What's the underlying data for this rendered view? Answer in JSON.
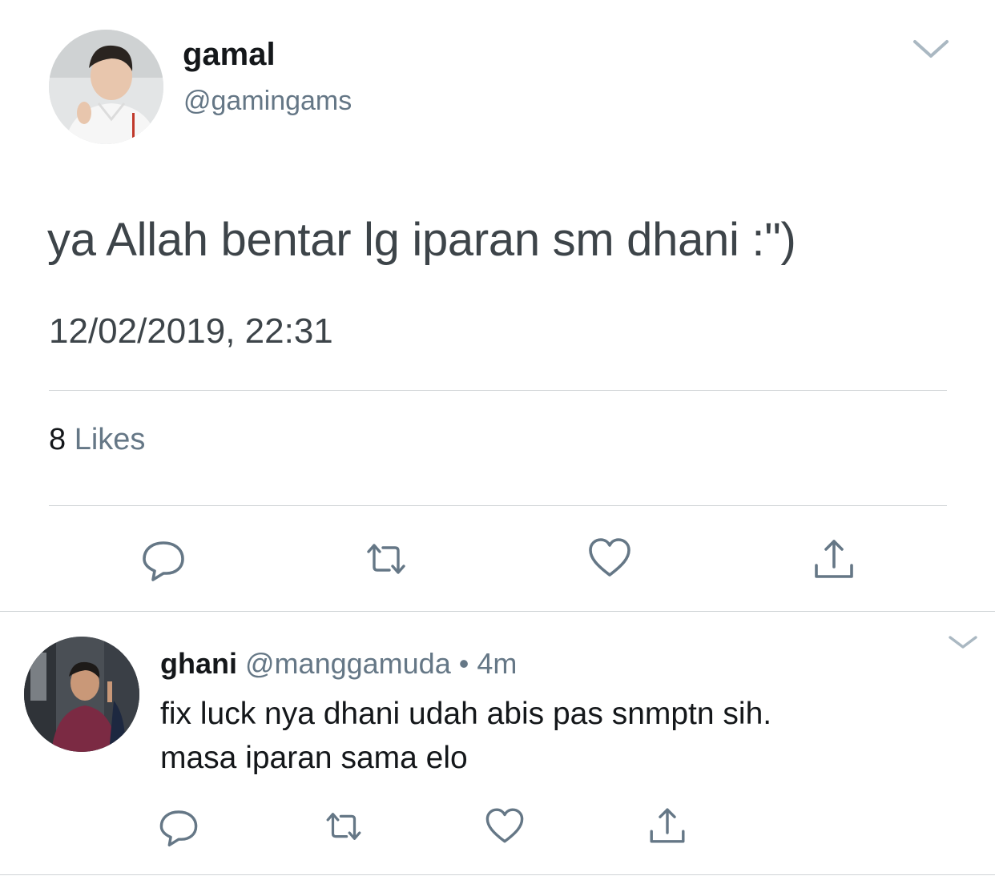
{
  "tweet": {
    "author": {
      "display_name": "gamal",
      "handle": "@gamingams"
    },
    "text": "ya Allah bentar lg iparan sm dhani :\")",
    "timestamp": "12/02/2019, 22:31",
    "likes": {
      "count": "8",
      "label": "Likes"
    },
    "actions": {
      "reply_icon": "reply-icon",
      "retweet_icon": "retweet-icon",
      "like_icon": "heart-icon",
      "share_icon": "share-icon"
    }
  },
  "reply": {
    "author": {
      "display_name": "ghani",
      "handle": "@manggamuda"
    },
    "separator": "•",
    "time": "4m",
    "lines": [
      "fix luck nya dhani udah abis pas snmptn sih.",
      "masa iparan sama elo"
    ]
  },
  "colors": {
    "icon_gray": "#657786",
    "divider": "#cfd3d6",
    "text_primary": "#14171a",
    "text_secondary": "#657786"
  }
}
